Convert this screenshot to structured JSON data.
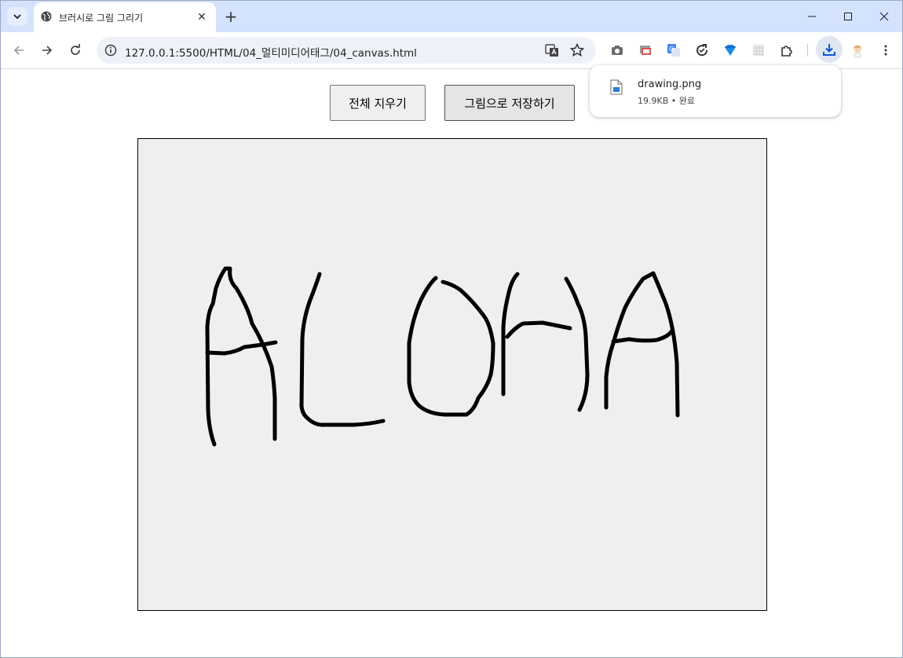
{
  "browser": {
    "tab_title": "브러시로 그림 그리기",
    "url": "127.0.0.1:5500/HTML/04_멀티미디어태그/04_canvas.html"
  },
  "page": {
    "clear_button": "전체 지우기",
    "save_button": "그림으로 저장하기",
    "canvas_background": "#efefef",
    "stroke_color": "#000000",
    "drawing_text": "ALOHA"
  },
  "download": {
    "file_name": "drawing.png",
    "meta": "19.9KB • 완료"
  },
  "colors": {
    "tabstrip": "#d3e3fd",
    "accent": "#0b57d0"
  }
}
